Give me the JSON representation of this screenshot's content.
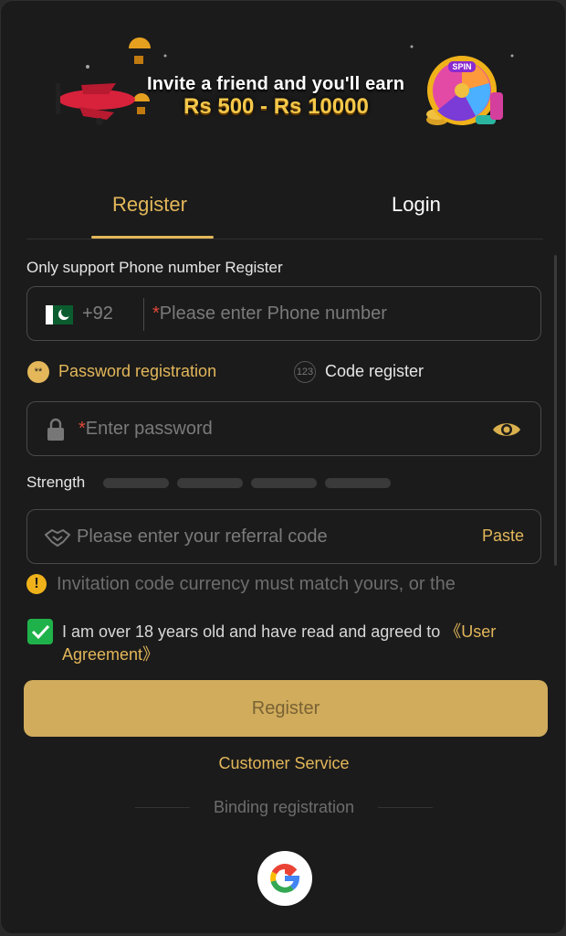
{
  "banner": {
    "line1": "Invite a friend and you'll earn",
    "line2": "Rs 500 - Rs 10000",
    "wheel_text": "SPIN"
  },
  "tabs": {
    "register": "Register",
    "login": "Login"
  },
  "phone": {
    "heading": "Only support Phone number Register",
    "country_code": "+92",
    "required_mark": "*",
    "placeholder": "Please enter Phone number"
  },
  "options": {
    "password_icon": "**",
    "password_label": "Password registration",
    "code_icon": "123",
    "code_label": "Code register"
  },
  "password": {
    "required_mark": "*",
    "placeholder": "Enter password"
  },
  "strength": {
    "label": "Strength"
  },
  "referral": {
    "placeholder": "Please enter your referral code",
    "paste_label": "Paste"
  },
  "notice": {
    "icon": "!",
    "text": "Invitation code currency must match yours, or the"
  },
  "agreement": {
    "checked": true,
    "text": "I am over 18 years old and have read and agreed to ",
    "link": "《User Agreement》"
  },
  "register_button": "Register",
  "customer_service": "Customer Service",
  "binding": "Binding registration",
  "colors": {
    "accent": "#e3b75a",
    "button": "#d0ac5c",
    "background": "#1b1b1b",
    "check": "#20b24a"
  }
}
